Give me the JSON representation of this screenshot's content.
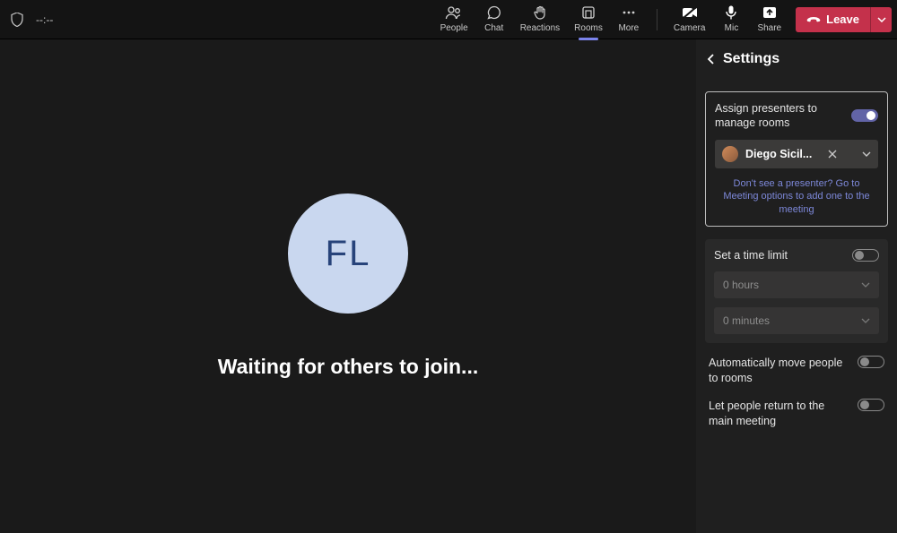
{
  "topbar": {
    "timer": "--:--",
    "menu": {
      "people": {
        "label": "People"
      },
      "chat": {
        "label": "Chat"
      },
      "reactions": {
        "label": "Reactions"
      },
      "rooms": {
        "label": "Rooms"
      },
      "more": {
        "label": "More"
      },
      "camera": {
        "label": "Camera"
      },
      "mic": {
        "label": "Mic"
      },
      "share": {
        "label": "Share"
      }
    },
    "leave_label": "Leave"
  },
  "stage": {
    "avatar_initials": "FL",
    "waiting_text": "Waiting for others to join..."
  },
  "panel": {
    "title": "Settings",
    "assign_presenters": {
      "label": "Assign presenters to manage rooms",
      "value": true
    },
    "presenter": {
      "name": "Diego Sicil..."
    },
    "presenter_hint": "Don't see a presenter? Go to Meeting options to add one to the meeting",
    "time_limit": {
      "label": "Set a time limit",
      "value": false,
      "hours_label": "0 hours",
      "minutes_label": "0 minutes"
    },
    "auto_move": {
      "label": "Automatically move people to rooms",
      "value": false
    },
    "return_main": {
      "label": "Let people return to the main meeting",
      "value": false
    }
  }
}
